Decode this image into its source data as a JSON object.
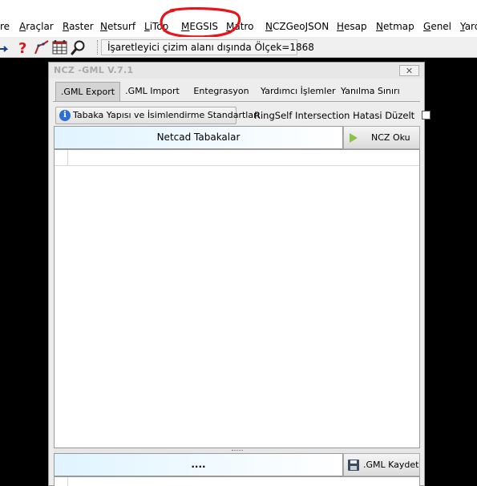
{
  "menu": {
    "items": [
      {
        "pre": "",
        "u": "",
        "post": "re"
      },
      {
        "pre": "",
        "u": "A",
        "post": "raçlar"
      },
      {
        "pre": "",
        "u": "R",
        "post": "aster"
      },
      {
        "pre": "",
        "u": "N",
        "post": "etsurf"
      },
      {
        "pre": "",
        "u": "L",
        "post": "iTop"
      },
      {
        "pre": "",
        "u": "M",
        "post": "EGSIS"
      },
      {
        "pre": "",
        "u": "M",
        "post": "atro"
      },
      {
        "pre": "",
        "u": "N",
        "post": "CZGeoJSON"
      },
      {
        "pre": "",
        "u": "H",
        "post": "esap"
      },
      {
        "pre": "",
        "u": "N",
        "post": "etmap"
      },
      {
        "pre": "",
        "u": "G",
        "post": "enel"
      },
      {
        "pre": "",
        "u": "Y",
        "post": "ardım"
      }
    ]
  },
  "toolbar": {
    "status": "İşaretleyici çizim alanı dışında Ölçek=1868",
    "icons": [
      "arrow-icon",
      "help-icon",
      "polyline-icon",
      "grid-icon",
      "magnifier-icon"
    ]
  },
  "annotation": {
    "color": "#e8141c"
  },
  "dialog": {
    "title": "NCZ -GML V.7.1",
    "close_label": "✕",
    "tabs": [
      ".GML Export",
      ".GML Import",
      "Entegrasyon",
      "Yardımcı İşlemler",
      "Yanılma Sınırı"
    ],
    "active_tab": 0,
    "info_button": "Tabaka Yapısı ve İsimlendirme Standartları",
    "ring_label": "RingSelf Intersection Hatasi Düzelt",
    "ring_checked": false,
    "layers_header": "Netcad Tabakalar",
    "ncz_button": "NCZ Oku",
    "file_field": "....",
    "save_button": ".GML Kaydet"
  },
  "colors": {
    "accent_play": "#8bc34a",
    "info_blue": "#2d6fcf"
  }
}
